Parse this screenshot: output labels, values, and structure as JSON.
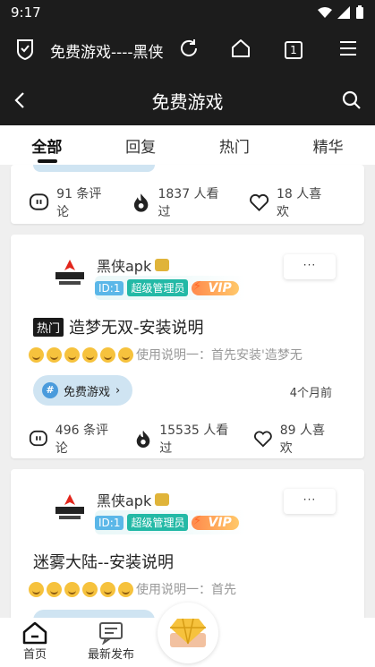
{
  "status_bar": {
    "time": "9:17"
  },
  "browser": {
    "tab_title": "免费游戏----黑侠",
    "tab_count": "1"
  },
  "header": {
    "title": "免费游戏"
  },
  "tabs": [
    {
      "label": "全部"
    },
    {
      "label": "回复"
    },
    {
      "label": "热门"
    },
    {
      "label": "精华"
    }
  ],
  "posts": [
    {
      "comments": "91 条评论",
      "views": "1837 人看过",
      "likes": "18 人喜欢"
    },
    {
      "username": "黑侠apk",
      "id_badge": "ID:1",
      "role_badge": "超级管理员",
      "vip": "VIP",
      "more": "···",
      "hot_tag": "热门",
      "title": "造梦无双-安装说明",
      "excerpt": "使用说明一：首先安装'造梦无",
      "category": "免费游戏",
      "time": "4个月前",
      "comments": "496 条评论",
      "views": "15535 人看过",
      "likes": "89 人喜欢"
    },
    {
      "username": "黑侠apk",
      "id_badge": "ID:1",
      "role_badge": "超级管理员",
      "vip": "VIP",
      "more": "···",
      "title": "迷雾大陆--安装说明",
      "excerpt": "使用说明一：首先"
    }
  ],
  "bottom_nav": {
    "home": "首页",
    "latest": "最新发布"
  },
  "colors": {
    "dark": "#1c1c1c",
    "accent_teal": "#23b9a6",
    "accent_blue": "#5bb7e8",
    "tag_bg": "#cfe4f2"
  }
}
